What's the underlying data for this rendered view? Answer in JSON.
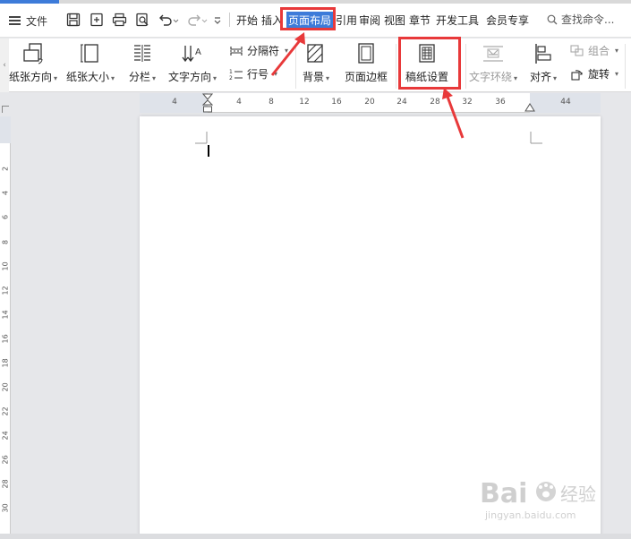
{
  "menu": {
    "file_label": "文件",
    "tabs": [
      "开始",
      "插入",
      "页面布局",
      "引用",
      "审阅",
      "视图",
      "章节",
      "开发工具",
      "会员专享"
    ],
    "active_tab": "页面布局",
    "search_placeholder": "查找命令..."
  },
  "ribbon": {
    "orientation": "纸张方向",
    "size": "纸张大小",
    "columns": "分栏",
    "text_direction": "文字方向",
    "breaks": "分隔符",
    "line_numbers": "行号",
    "background": "背景",
    "page_border": "页面边框",
    "manuscript": "稿纸设置",
    "text_wrap": "文字环绕",
    "align": "对齐",
    "group": "组合",
    "rotate": "旋转"
  },
  "ruler": {
    "h_ticks": [
      "4",
      "4",
      "8",
      "12",
      "16",
      "20",
      "24",
      "28",
      "32",
      "36",
      "44"
    ],
    "v_ticks": [
      "2",
      "4",
      "6",
      "8",
      "10",
      "12",
      "14",
      "16",
      "18",
      "20",
      "22",
      "24",
      "26",
      "28",
      "30"
    ]
  },
  "watermark": {
    "brand": "Bai",
    "brand_suffix": "经验",
    "url": "jingyan.baidu.com"
  },
  "colors": {
    "accent": "#3d7bd9",
    "highlight": "#e8393a"
  }
}
